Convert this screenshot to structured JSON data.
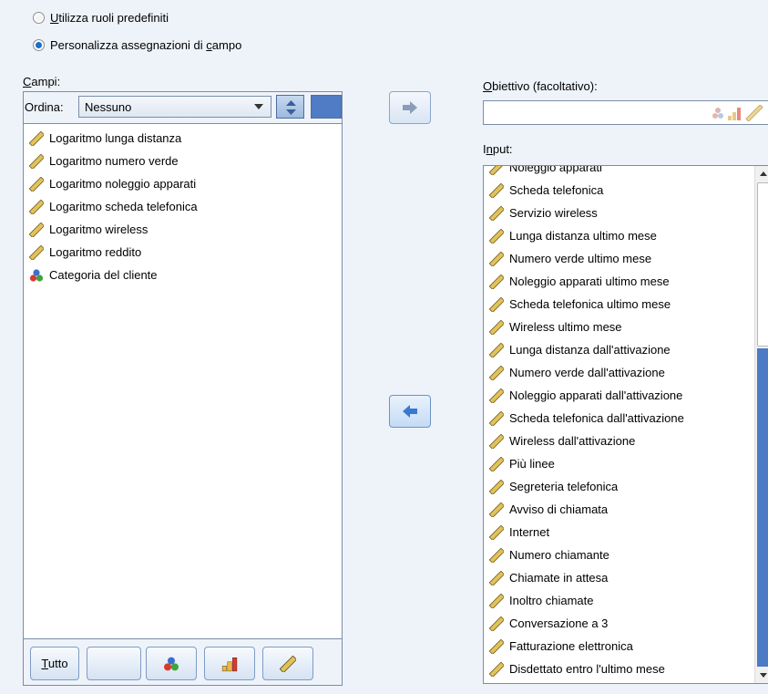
{
  "roles": {
    "option1": {
      "pre": "",
      "key": "U",
      "post": "tilizza ruoli predefiniti",
      "selected": false
    },
    "option2": {
      "pre": "Personalizza assegnazioni di ",
      "key": "c",
      "post": "ampo",
      "selected": true
    }
  },
  "fields": {
    "label_key": "C",
    "label_rest": "ampi:",
    "sort_label": "Ordina:",
    "sort_value": "Nessuno",
    "items": [
      {
        "label": "Logaritmo lunga distanza",
        "icon": "ruler-icon"
      },
      {
        "label": "Logaritmo numero verde",
        "icon": "ruler-icon"
      },
      {
        "label": "Logaritmo noleggio apparati",
        "icon": "ruler-icon"
      },
      {
        "label": "Logaritmo scheda telefonica",
        "icon": "ruler-icon"
      },
      {
        "label": "Logaritmo wireless",
        "icon": "ruler-icon"
      },
      {
        "label": "Logaritmo reddito",
        "icon": "ruler-icon"
      },
      {
        "label": "Categoria del cliente",
        "icon": "nominal-icon"
      }
    ],
    "filter_all_key": "T",
    "filter_all_rest": "utto"
  },
  "target": {
    "label_key": "O",
    "label_rest": "biettivo (facoltativo):"
  },
  "input": {
    "label_pre": "I",
    "label_key": "n",
    "label_rest": "put:",
    "items": [
      "Noleggio apparati",
      "Scheda telefonica",
      "Servizio wireless",
      "Lunga distanza ultimo mese",
      "Numero verde ultimo mese",
      "Noleggio apparati ultimo mese",
      "Scheda telefonica ultimo mese",
      "Wireless ultimo mese",
      "Lunga distanza dall'attivazione",
      "Numero verde dall'attivazione",
      "Noleggio apparati dall'attivazione",
      "Scheda telefonica dall'attivazione",
      "Wireless dall'attivazione",
      "Più linee",
      "Segreteria telefonica",
      "Avviso di chiamata",
      "Internet",
      "Numero chiamante",
      "Chiamate in attesa",
      "Inoltro chiamate",
      "Conversazione a 3",
      "Fatturazione elettronica",
      "Disdettato entro l'ultimo mese"
    ]
  },
  "colors": {
    "accent": "#1a6fc9",
    "arrow": "#3a78d0",
    "ruler": "#c9a32c"
  }
}
